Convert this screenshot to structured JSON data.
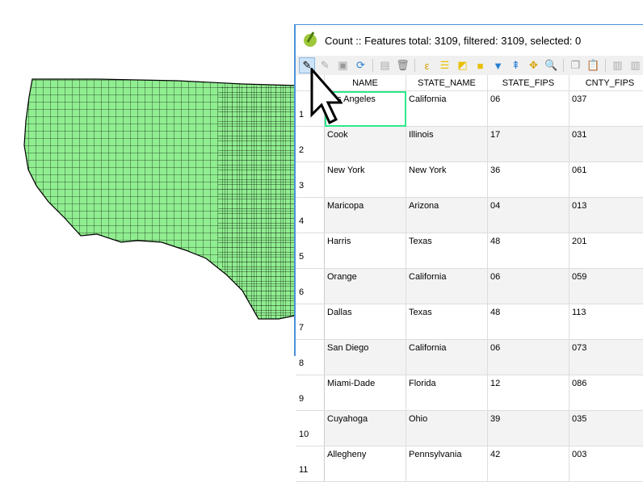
{
  "window": {
    "title": "Count :: Features total: 3109, filtered: 3109, selected: 0"
  },
  "toolbar": [
    "pencil-icon",
    "edit-multi-icon",
    "save-icon",
    "reload-icon",
    "add-feature-icon",
    "delete-icon",
    "select-expression-icon",
    "select-all-icon",
    "invert-selection-icon",
    "deselect-icon",
    "filter-icon",
    "move-selection-top-icon",
    "pan-to-selection-icon",
    "zoom-to-selection-icon",
    "copy-icon",
    "paste-icon",
    "new-field-icon",
    "delete-field-icon"
  ],
  "columns": [
    "NAME",
    "STATE_NAME",
    "STATE_FIPS",
    "CNTY_FIPS"
  ],
  "rows": [
    {
      "n": "1",
      "c": [
        "Los Angeles",
        "California",
        "06",
        "037"
      ]
    },
    {
      "n": "2",
      "c": [
        "Cook",
        "Illinois",
        "17",
        "031"
      ]
    },
    {
      "n": "3",
      "c": [
        "New York",
        "New York",
        "36",
        "061"
      ]
    },
    {
      "n": "4",
      "c": [
        "Maricopa",
        "Arizona",
        "04",
        "013"
      ]
    },
    {
      "n": "5",
      "c": [
        "Harris",
        "Texas",
        "48",
        "201"
      ]
    },
    {
      "n": "6",
      "c": [
        "Orange",
        "California",
        "06",
        "059"
      ]
    },
    {
      "n": "7",
      "c": [
        "Dallas",
        "Texas",
        "48",
        "113"
      ]
    },
    {
      "n": "8",
      "c": [
        "San Diego",
        "California",
        "06",
        "073"
      ]
    },
    {
      "n": "9",
      "c": [
        "Miami-Dade",
        "Florida",
        "12",
        "086"
      ]
    },
    {
      "n": "10",
      "c": [
        "Cuyahoga",
        "Ohio",
        "39",
        "035"
      ]
    },
    {
      "n": "11",
      "c": [
        "Allegheny",
        "Pennsylvania",
        "42",
        "003"
      ]
    }
  ],
  "colors": {
    "map_fill": "#90ee90",
    "selection": "#2ee88a"
  }
}
